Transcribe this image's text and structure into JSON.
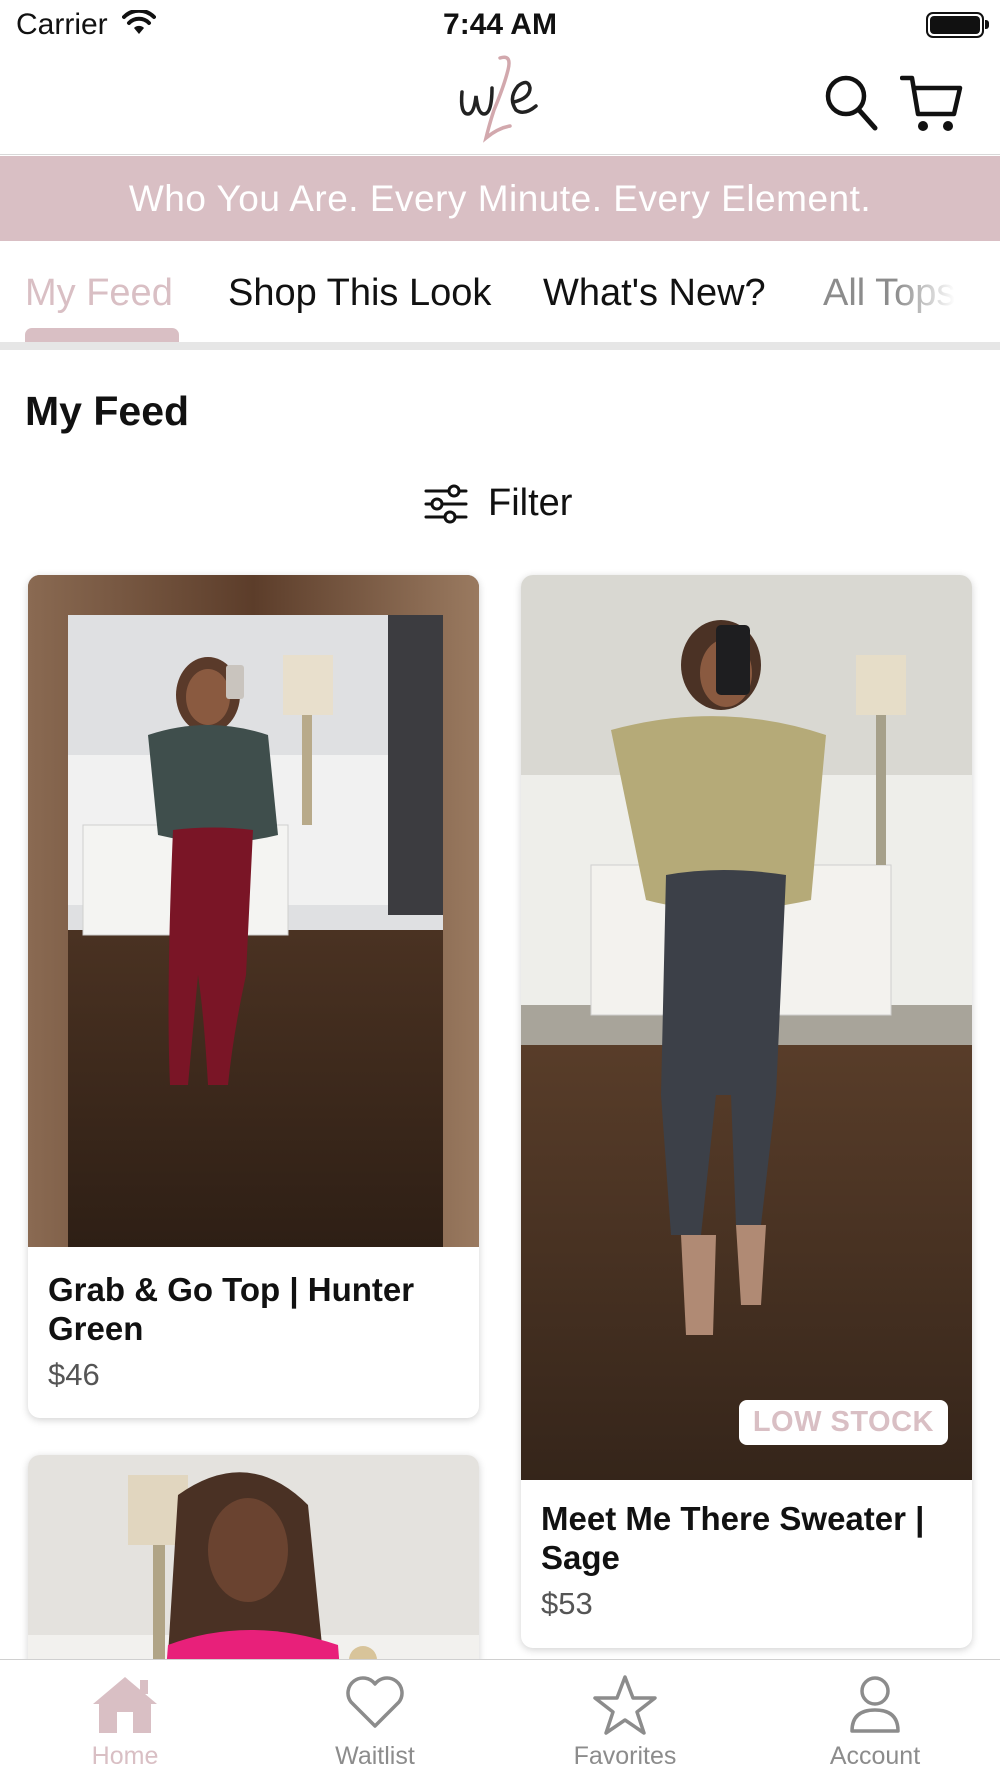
{
  "status_bar": {
    "carrier": "Carrier",
    "time": "7:44 AM"
  },
  "header": {
    "logo_text": "w2e",
    "search_icon": "search-icon",
    "cart_icon": "cart-icon"
  },
  "banner": {
    "text": "Who You Are. Every Minute. Every Element."
  },
  "tabs": [
    {
      "label": "My Feed",
      "active": true
    },
    {
      "label": "Shop This Look",
      "active": false
    },
    {
      "label": "What's New?",
      "active": false
    },
    {
      "label": "All Tops",
      "active": false
    }
  ],
  "feed": {
    "title": "My Feed",
    "filter_label": "Filter",
    "products": [
      {
        "name": "Grab & Go Top | Hunter Green",
        "price": "$46",
        "badge": ""
      },
      {
        "name": "Meet Me There Sweater | Sage",
        "price": "$53",
        "badge": "LOW STOCK"
      },
      {
        "name": "",
        "price": "",
        "badge": ""
      }
    ]
  },
  "bottom_nav": [
    {
      "label": "Home",
      "icon": "home-icon",
      "active": true
    },
    {
      "label": "Waitlist",
      "icon": "heart-icon",
      "active": false
    },
    {
      "label": "Favorites",
      "icon": "star-icon",
      "active": false
    },
    {
      "label": "Account",
      "icon": "user-icon",
      "active": false
    }
  ],
  "colors": {
    "accent": "#d9bfc4",
    "text": "#111111",
    "muted": "#8c8c8c"
  }
}
